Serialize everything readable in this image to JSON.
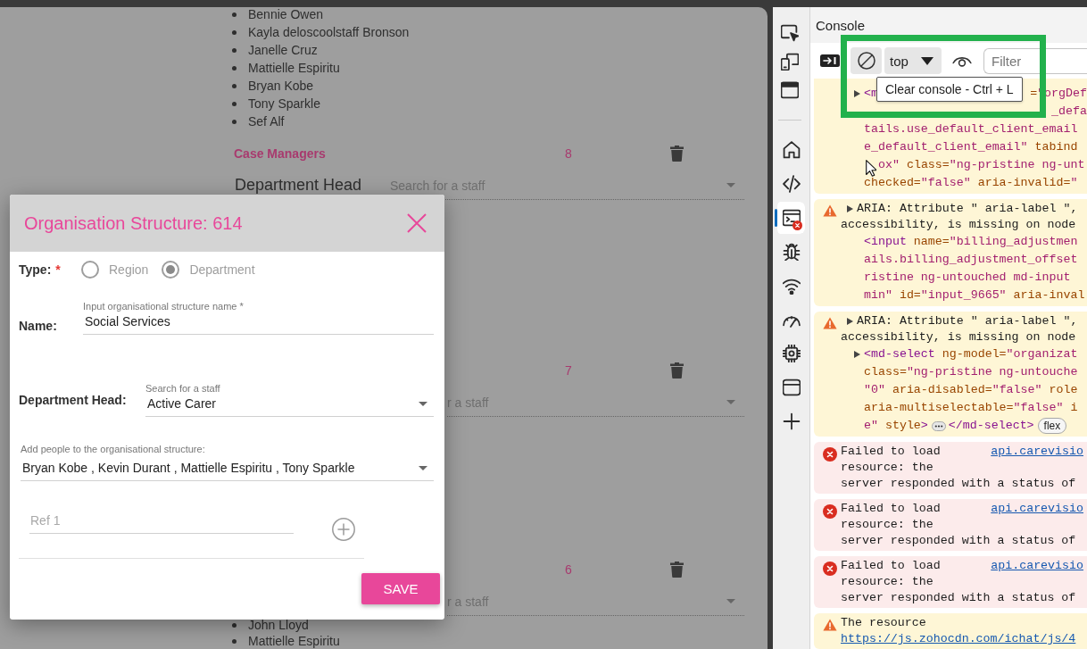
{
  "page": {
    "top_list": [
      "Bennie Owen",
      "Kayla deloscoolstaff Bronson",
      "Janelle Cruz",
      "Mattielle Espiritu",
      "Bryan Kobe",
      "Tony Sparkle",
      "Sef Alf"
    ],
    "groups": [
      {
        "title": "Case Managers",
        "count": "8",
        "head_label": "Department Head",
        "head_placeholder": "Search for a staff"
      },
      {
        "count": "7",
        "head_placeholder": "r a staff"
      },
      {
        "count": "6",
        "head_placeholder": "r a staff"
      }
    ],
    "bottom_list": [
      "John Lloyd",
      "Mattielle Espiritu"
    ]
  },
  "dialog": {
    "title": "Organisation Structure: 614",
    "type_label": "Type:",
    "required_mark": "*",
    "type_options": [
      {
        "label": "Region",
        "selected": false,
        "disabled": true
      },
      {
        "label": "Department",
        "selected": true,
        "disabled": true
      }
    ],
    "name_label": "Name:",
    "name_field": {
      "label": "Input organisational structure name *",
      "value": "Social Services"
    },
    "head_label": "Department Head:",
    "head_field": {
      "label": "Search for a staff",
      "value": "Active Carer"
    },
    "people_field": {
      "label": "Add people to the organisational structure:",
      "value": "Bryan Kobe , Kevin Durant , Mattielle Espiritu , Tony Sparkle"
    },
    "ref_field": {
      "placeholder": "Ref 1"
    },
    "save_button": "SAVE"
  },
  "devtools": {
    "sidebar": {
      "actions": [
        {
          "kind": "inspect"
        },
        {
          "kind": "device"
        },
        {
          "kind": "dock"
        }
      ],
      "tools": [
        {
          "kind": "home",
          "selected": false,
          "error_badge": false
        },
        {
          "kind": "elements",
          "selected": false,
          "error_badge": false
        },
        {
          "kind": "console",
          "selected": true,
          "error_badge": true
        },
        {
          "kind": "sources",
          "selected": false,
          "error_badge": false
        },
        {
          "kind": "network",
          "selected": false,
          "error_badge": false
        },
        {
          "kind": "performance",
          "selected": false,
          "error_badge": false
        },
        {
          "kind": "memory",
          "selected": false,
          "error_badge": false
        },
        {
          "kind": "application",
          "selected": false,
          "error_badge": false
        },
        {
          "kind": "more",
          "selected": false,
          "error_badge": false
        }
      ]
    },
    "panel_title": "Console",
    "toolbar": {
      "context": "top",
      "filter_placeholder": "Filter"
    },
    "tooltip": "Clear console - Ctrl + L",
    "messages": [
      {
        "kind": "warning",
        "cut_off": true,
        "lines": [
          {
            "kind": "code",
            "expanded": false,
            "segments": [
              {
                "kind": "tag",
                "text": "<m"
              }
            ],
            "segments_right": [
              {
                "kind": "attr",
                "text": "="
              },
              {
                "kind": "value",
                "text": "\"orgDef"
              }
            ]
          },
          {
            "kind": "code",
            "segments_right": [
              {
                "kind": "value",
                "text": "_defa"
              }
            ]
          },
          {
            "kind": "code",
            "segments": [
              {
                "kind": "value",
                "text": "tails.use_default_client_email"
              }
            ]
          },
          {
            "kind": "code",
            "segments": [
              {
                "kind": "value",
                "text": "e_default_client_email\""
              },
              {
                "kind": "attr",
                "text": " tabind"
              }
            ]
          },
          {
            "kind": "code",
            "cursor": true,
            "segments": [
              {
                "kind": "value",
                "text": "ox\""
              },
              {
                "kind": "attr",
                "text": " class="
              },
              {
                "kind": "value",
                "text": "\"ng-pristine ng-unt"
              }
            ]
          },
          {
            "kind": "code",
            "segments": [
              {
                "kind": "attr",
                "text": "checked="
              },
              {
                "kind": "value",
                "text": "\"false\""
              },
              {
                "kind": "attr",
                "text": " aria-invalid="
              },
              {
                "kind": "value",
                "text": "\""
              }
            ]
          }
        ]
      },
      {
        "kind": "warning",
        "cut_off": false,
        "lines": [
          {
            "kind": "text",
            "expanded": false,
            "text": "ARIA: Attribute \" aria-label \","
          },
          {
            "kind": "text",
            "text": "accessibility, is missing on node"
          },
          {
            "kind": "code",
            "segments": [
              {
                "kind": "tag",
                "text": "<input"
              },
              {
                "kind": "attr",
                "text": " name="
              },
              {
                "kind": "value",
                "text": "\"billing_adjustmen"
              }
            ]
          },
          {
            "kind": "code",
            "segments": [
              {
                "kind": "value",
                "text": "ails.billing_adjustment_offset"
              }
            ]
          },
          {
            "kind": "code",
            "segments": [
              {
                "kind": "value",
                "text": "ristine ng-untouched md-input"
              }
            ]
          },
          {
            "kind": "code",
            "segments": [
              {
                "kind": "value",
                "text": "min\""
              },
              {
                "kind": "attr",
                "text": " id="
              },
              {
                "kind": "value",
                "text": "\"input_9665\""
              },
              {
                "kind": "attr",
                "text": " aria-inval"
              }
            ]
          }
        ]
      },
      {
        "kind": "warning",
        "cut_off": false,
        "lines": [
          {
            "kind": "text",
            "expanded": false,
            "text": "ARIA: Attribute \" aria-label \","
          },
          {
            "kind": "text",
            "text": "accessibility, is missing on node"
          },
          {
            "kind": "code",
            "expanded": false,
            "segments": [
              {
                "kind": "tag",
                "text": "<md-select"
              },
              {
                "kind": "attr",
                "text": " ng-model="
              },
              {
                "kind": "value",
                "text": "\"organizat"
              }
            ]
          },
          {
            "kind": "code",
            "segments": [
              {
                "kind": "attr",
                "text": "class="
              },
              {
                "kind": "value",
                "text": "\"ng-pristine ng-untouche"
              }
            ]
          },
          {
            "kind": "code",
            "segments": [
              {
                "kind": "value",
                "text": "\"0\""
              },
              {
                "kind": "attr",
                "text": " aria-disabled="
              },
              {
                "kind": "value",
                "text": "\"false\""
              },
              {
                "kind": "attr",
                "text": " role"
              }
            ]
          },
          {
            "kind": "code",
            "segments": [
              {
                "kind": "attr",
                "text": "aria-multiselectable="
              },
              {
                "kind": "value",
                "text": "\"false\""
              },
              {
                "kind": "attr",
                "text": " i"
              }
            ]
          },
          {
            "kind": "code",
            "segments": [
              {
                "kind": "value",
                "text": "e\""
              },
              {
                "kind": "attr",
                "text": " style"
              },
              {
                "kind": "tag",
                "text": ">"
              },
              {
                "kind": "ellipsis"
              },
              {
                "kind": "tag",
                "text": "</md-select>"
              },
              {
                "kind": "badge",
                "text": "flex"
              }
            ]
          }
        ]
      },
      {
        "kind": "error",
        "cut_off": false,
        "lines": [
          {
            "kind": "text",
            "text": "Failed to load",
            "link": "api.carevisio"
          },
          {
            "kind": "text",
            "text": "resource: the"
          },
          {
            "kind": "text",
            "text": "server responded with a status of"
          }
        ]
      },
      {
        "kind": "error",
        "cut_off": false,
        "lines": [
          {
            "kind": "text",
            "text": "Failed to load",
            "link": "api.carevisio"
          },
          {
            "kind": "text",
            "text": "resource: the"
          },
          {
            "kind": "text",
            "text": "server responded with a status of"
          }
        ]
      },
      {
        "kind": "error",
        "cut_off": false,
        "lines": [
          {
            "kind": "text",
            "text": "Failed to load",
            "link": "api.carevisio"
          },
          {
            "kind": "text",
            "text": "resource: the"
          },
          {
            "kind": "text",
            "text": "server responded with a status of"
          }
        ]
      },
      {
        "kind": "warning",
        "cut_off": false,
        "lines": [
          {
            "kind": "text",
            "text": "The resource"
          },
          {
            "kind": "link",
            "text": "https://js.zohocdn.com/ichat/js/4"
          }
        ]
      }
    ]
  }
}
